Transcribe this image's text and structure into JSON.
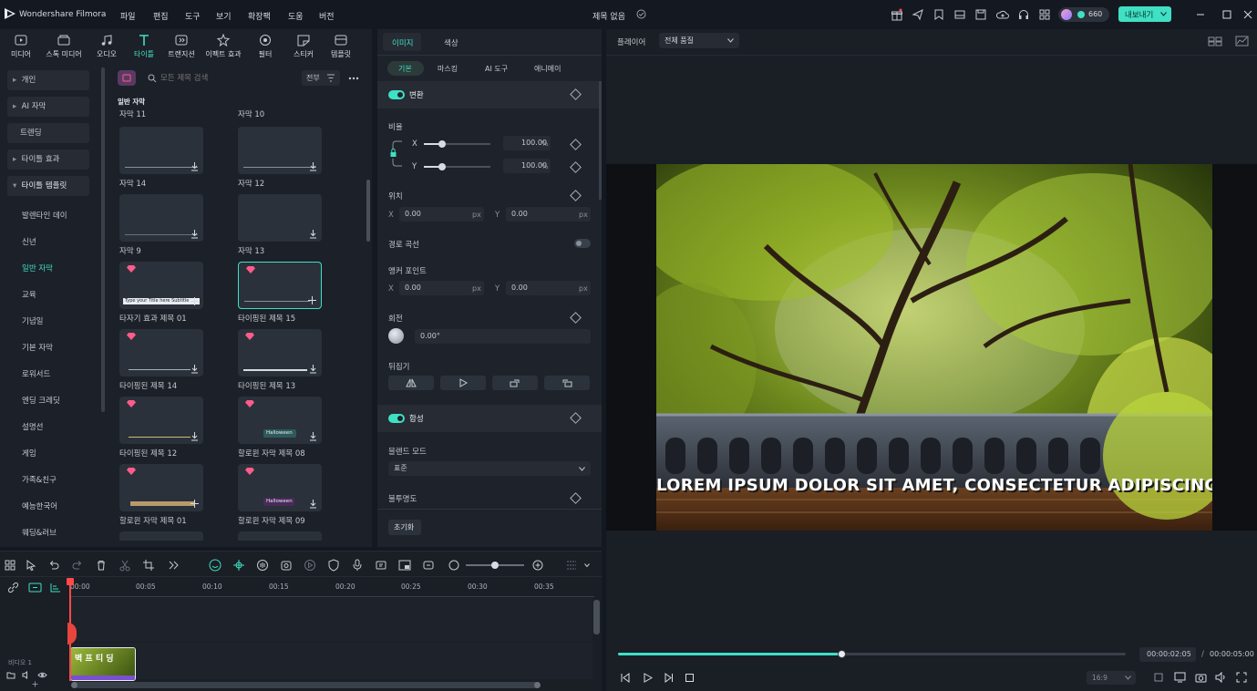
{
  "app": {
    "name": "Wondershare Filmora",
    "menus": [
      "파일",
      "편집",
      "도구",
      "보기",
      "확장팩",
      "도움",
      "버전"
    ],
    "project_title": "제목 없음",
    "credits": "660",
    "export_label": "내보내기"
  },
  "media_tabs": [
    {
      "label": "미디어",
      "icon": "media-icon"
    },
    {
      "label": "스톡 미디어",
      "icon": "stock-media-icon"
    },
    {
      "label": "오디오",
      "icon": "audio-icon"
    },
    {
      "label": "타이틀",
      "icon": "title-icon",
      "active": true
    },
    {
      "label": "트랜지션",
      "icon": "transition-icon"
    },
    {
      "label": "이펙트 효과",
      "icon": "effects-icon"
    },
    {
      "label": "필터",
      "icon": "filter-icon"
    },
    {
      "label": "스티커",
      "icon": "sticker-icon"
    },
    {
      "label": "템플릿",
      "icon": "template-icon"
    }
  ],
  "search": {
    "placeholder": "모든 제목 검색",
    "filter_label": "전부"
  },
  "sidebar": {
    "items": [
      {
        "label": "개인",
        "expandable": true
      },
      {
        "label": "AI 자막",
        "expandable": true
      },
      {
        "label": "트렌딩",
        "expandable": false
      },
      {
        "label": "타이틀 효과",
        "expandable": true
      },
      {
        "label": "타이틀 템플릿",
        "expandable": true,
        "expanded": true
      }
    ],
    "subitems": [
      "발렌타인 데이",
      "신년",
      "일반 자막",
      "교육",
      "기념일",
      "기본 자막",
      "로워서드",
      "엔딩 크레딧",
      "설명선",
      "게임",
      "가족&친구",
      "예능한국어",
      "웨딩&러브"
    ],
    "active_subitem": "일반 자막"
  },
  "content": {
    "section_title": "일반 자막",
    "prev_row": [
      "자막 11",
      "자막 10"
    ],
    "thumbnails": [
      {
        "caption": "자막 14",
        "premium": false,
        "text": ""
      },
      {
        "caption": "자막 12",
        "premium": false,
        "text": ""
      },
      {
        "caption": "자막 9",
        "premium": false,
        "text": ""
      },
      {
        "caption": "자막 13",
        "premium": false,
        "text": ""
      },
      {
        "caption": "타자기 효과 제목 01",
        "premium": true,
        "text": "Type your Title here Subtitle"
      },
      {
        "caption": "타이핑된 제목 15",
        "premium": true,
        "selected": true,
        "text": ""
      },
      {
        "caption": "타이핑된 제목 14",
        "premium": true,
        "text": ""
      },
      {
        "caption": "타이핑된 제목 13",
        "premium": true,
        "text": ""
      },
      {
        "caption": "타이핑된 제목 12",
        "premium": true,
        "text": ""
      },
      {
        "caption": "할로윈 자막 제목 08",
        "premium": true,
        "text": "Halloween"
      },
      {
        "caption": "할로윈 자막 제목 01",
        "premium": true,
        "text": ""
      },
      {
        "caption": "할로윈 자막 제목 09",
        "premium": true,
        "text": "Halloween"
      }
    ]
  },
  "inspector": {
    "tabs": [
      "이미지",
      "색상"
    ],
    "subtabs": [
      "기본",
      "마스킹",
      "AI 도구",
      "애니메이"
    ],
    "transform": {
      "title": "변환",
      "scale_label": "비율",
      "scale_x": "100.00",
      "scale_y": "100.00",
      "unit_pct": "%",
      "position_label": "위치",
      "pos_x": "0.00",
      "pos_y": "0.00",
      "unit_px": "px",
      "path_curve_label": "경로 곡선",
      "anchor_label": "앵커 포인트",
      "anchor_x": "0.00",
      "anchor_y": "0.00",
      "rotation_label": "회전",
      "rotation_value": "0.00°",
      "flip_label": "뒤집기"
    },
    "composite": {
      "title": "합성",
      "blend_label": "블렌드 모드",
      "blend_value": "표준",
      "opacity_label": "불투명도"
    },
    "reset_label": "초기화"
  },
  "preview": {
    "player_label": "플레이어",
    "quality": "전체 품질",
    "caption": "LOREM IPSUM DOLOR SIT AMET, CONSECTETUR ADIPISCING ELIT.",
    "current_time": "00:00:02:05",
    "total_time": "00:00:05:00",
    "progress": 0.44,
    "aspect": "16:9"
  },
  "timeline": {
    "ruler": [
      "00:00",
      "00:05",
      "00:10",
      "00:15",
      "00:20",
      "00:25",
      "00:30",
      "00:35"
    ],
    "track_label": "비디오 1",
    "clip_label": "벽 프 티 딩"
  },
  "colors": {
    "accent": "#3fe0c4",
    "premium": "#ff5c8a",
    "playhead": "#ff4a4a",
    "clip_purple": "#7b4fd1"
  }
}
